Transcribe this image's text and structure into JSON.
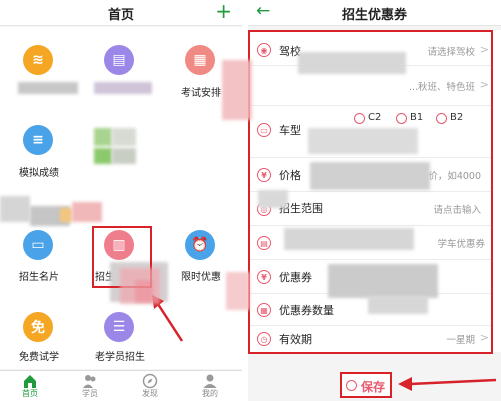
{
  "left": {
    "title": "首页",
    "add_icon": "plus-icon",
    "grid": [
      {
        "label": "",
        "icon": "audio-wave-icon",
        "color": "#f5a623"
      },
      {
        "label": "",
        "icon": "book-icon",
        "color": "#9b87e8"
      },
      {
        "label": "考试安排",
        "icon": "calendar-icon",
        "color": "#f08a84"
      },
      {
        "label": "模拟成绩",
        "icon": "document-icon",
        "color": "#4aa3e8"
      },
      {
        "label": "招生名片",
        "icon": "card-icon",
        "color": "#4aa3e8"
      },
      {
        "label": "招生优惠券",
        "icon": "coupon-icon",
        "color": "#ef7e8c"
      },
      {
        "label": "限时优惠",
        "icon": "alarm-clock-icon",
        "color": "#4aa3e8"
      },
      {
        "label": "免费试学",
        "icon": "free-badge-icon",
        "color": "#f5a623"
      },
      {
        "label": "老学员招生",
        "icon": "list-icon",
        "color": "#9b87e8"
      }
    ],
    "tabs": [
      {
        "label": "首页",
        "icon": "home-icon",
        "active": true
      },
      {
        "label": "学员",
        "icon": "students-icon",
        "active": false
      },
      {
        "label": "发现",
        "icon": "compass-icon",
        "active": false
      },
      {
        "label": "我的",
        "icon": "user-icon",
        "active": false
      }
    ]
  },
  "right": {
    "title": "招生优惠券",
    "back_icon": "back-arrow-icon",
    "rows": [
      {
        "label": "驾校",
        "value": "请选择驾校",
        "icon": "school-icon",
        "chevron": true
      },
      {
        "label": "",
        "value": "...秋班、特色班",
        "icon": "",
        "chevron": true
      },
      {
        "label": "车型",
        "value": "",
        "icon": "car-icon",
        "chevron": false
      },
      {
        "label": "价格",
        "value": "原价，如4000",
        "icon": "price-icon",
        "chevron": false
      },
      {
        "label": "招生范围",
        "value": "请点击输入",
        "icon": "range-icon",
        "chevron": false
      },
      {
        "label": "",
        "value": "学车优惠券",
        "icon": "coupon-name-icon",
        "chevron": false
      },
      {
        "label": "优惠券",
        "value": "",
        "icon": "yen-icon",
        "chevron": false
      },
      {
        "label": "优惠券数量",
        "value": "",
        "icon": "quantity-icon",
        "chevron": false
      },
      {
        "label": "有效期",
        "value": "一星期",
        "icon": "clock-icon",
        "chevron": true
      }
    ],
    "radios": [
      "C2",
      "B1",
      "B2"
    ],
    "save_label": "保存"
  }
}
